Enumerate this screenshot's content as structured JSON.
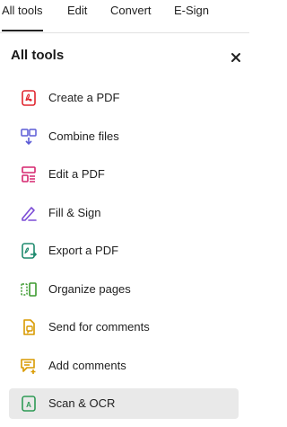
{
  "tabs": [
    {
      "label": "All tools",
      "active": true
    },
    {
      "label": "Edit",
      "active": false
    },
    {
      "label": "Convert",
      "active": false
    },
    {
      "label": "E-Sign",
      "active": false
    }
  ],
  "panel": {
    "title": "All tools",
    "close_icon": "close-icon"
  },
  "tools": [
    {
      "label": "Create a PDF",
      "icon": "create-pdf-icon",
      "color": "#e0262f"
    },
    {
      "label": "Combine files",
      "icon": "combine-files-icon",
      "color": "#5b5bd6"
    },
    {
      "label": "Edit a PDF",
      "icon": "edit-pdf-icon",
      "color": "#d6266f"
    },
    {
      "label": "Fill & Sign",
      "icon": "fill-sign-icon",
      "color": "#7b4bd6"
    },
    {
      "label": "Export a PDF",
      "icon": "export-pdf-icon",
      "color": "#1e8a6e"
    },
    {
      "label": "Organize pages",
      "icon": "organize-pages-icon",
      "color": "#3c9a2f"
    },
    {
      "label": "Send for comments",
      "icon": "send-comments-icon",
      "color": "#d99a00"
    },
    {
      "label": "Add comments",
      "icon": "add-comments-icon",
      "color": "#d99a00"
    },
    {
      "label": "Scan & OCR",
      "icon": "scan-ocr-icon",
      "color": "#2e9a55",
      "selected": true
    }
  ]
}
